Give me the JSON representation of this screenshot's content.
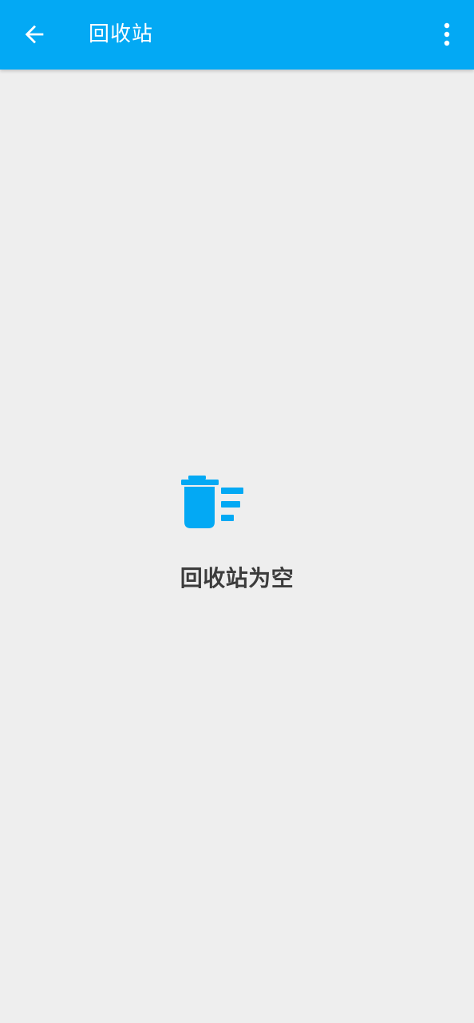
{
  "toolbar": {
    "title": "回收站",
    "back_icon": "arrow-left-icon",
    "more_icon": "more-vertical-icon",
    "background_color": "#03A9F4"
  },
  "empty_state": {
    "icon": "empty-trash-icon",
    "icon_color": "#03A9F4",
    "message": "回收站为空"
  },
  "colors": {
    "page_background": "#EEEEEE",
    "text_primary": "#3C3C3C"
  }
}
